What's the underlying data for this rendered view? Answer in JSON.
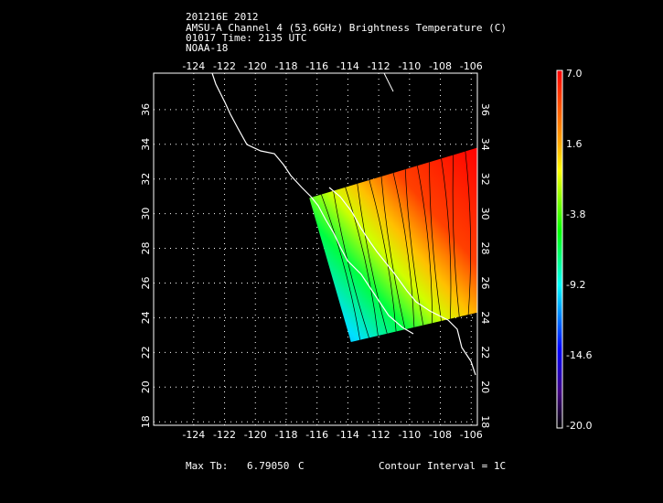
{
  "header": {
    "line1": "201216E 2012",
    "line2": "AMSU-A Channel 4 (53.6GHz) Brightness Temperature (C)",
    "line3": "01017 Time: 2135 UTC",
    "line4": "NOAA-18"
  },
  "footer": {
    "max_label": "Max Tb:",
    "max_value": "6.79050",
    "max_unit": "C",
    "contour": "Contour Interval = 1C"
  },
  "chart_data": {
    "type": "heatmap",
    "title": "AMSU-A Channel 4 (53.6GHz) Brightness Temperature (C)",
    "x_ticks": [
      "-124",
      "-122",
      "-120",
      "-118",
      "-116",
      "-114",
      "-112",
      "-110",
      "-108",
      "-106"
    ],
    "y_ticks": [
      "36",
      "34",
      "32",
      "30",
      "28",
      "26",
      "24",
      "22",
      "20",
      "18"
    ],
    "xlim": [
      -126.6,
      -105.6
    ],
    "ylim": [
      17.8,
      38.1
    ],
    "grid": true,
    "colorbar": {
      "labels": [
        "7.0",
        "1.6",
        "-3.8",
        "-9.2",
        "-14.6",
        "-20.0"
      ],
      "range": [
        -20.0,
        7.0
      ],
      "colors": [
        "#ff0000",
        "#ffa500",
        "#ffff00",
        "#00ff00",
        "#00ffff",
        "#0000ff",
        "#400080",
        "#000000"
      ]
    },
    "swath_corners_lonlat": [
      [
        -116.5,
        30.9
      ],
      [
        -105.6,
        33.8
      ],
      [
        -105.6,
        24.3
      ],
      [
        -113.8,
        22.6
      ]
    ],
    "contour_interval_C": 1
  }
}
